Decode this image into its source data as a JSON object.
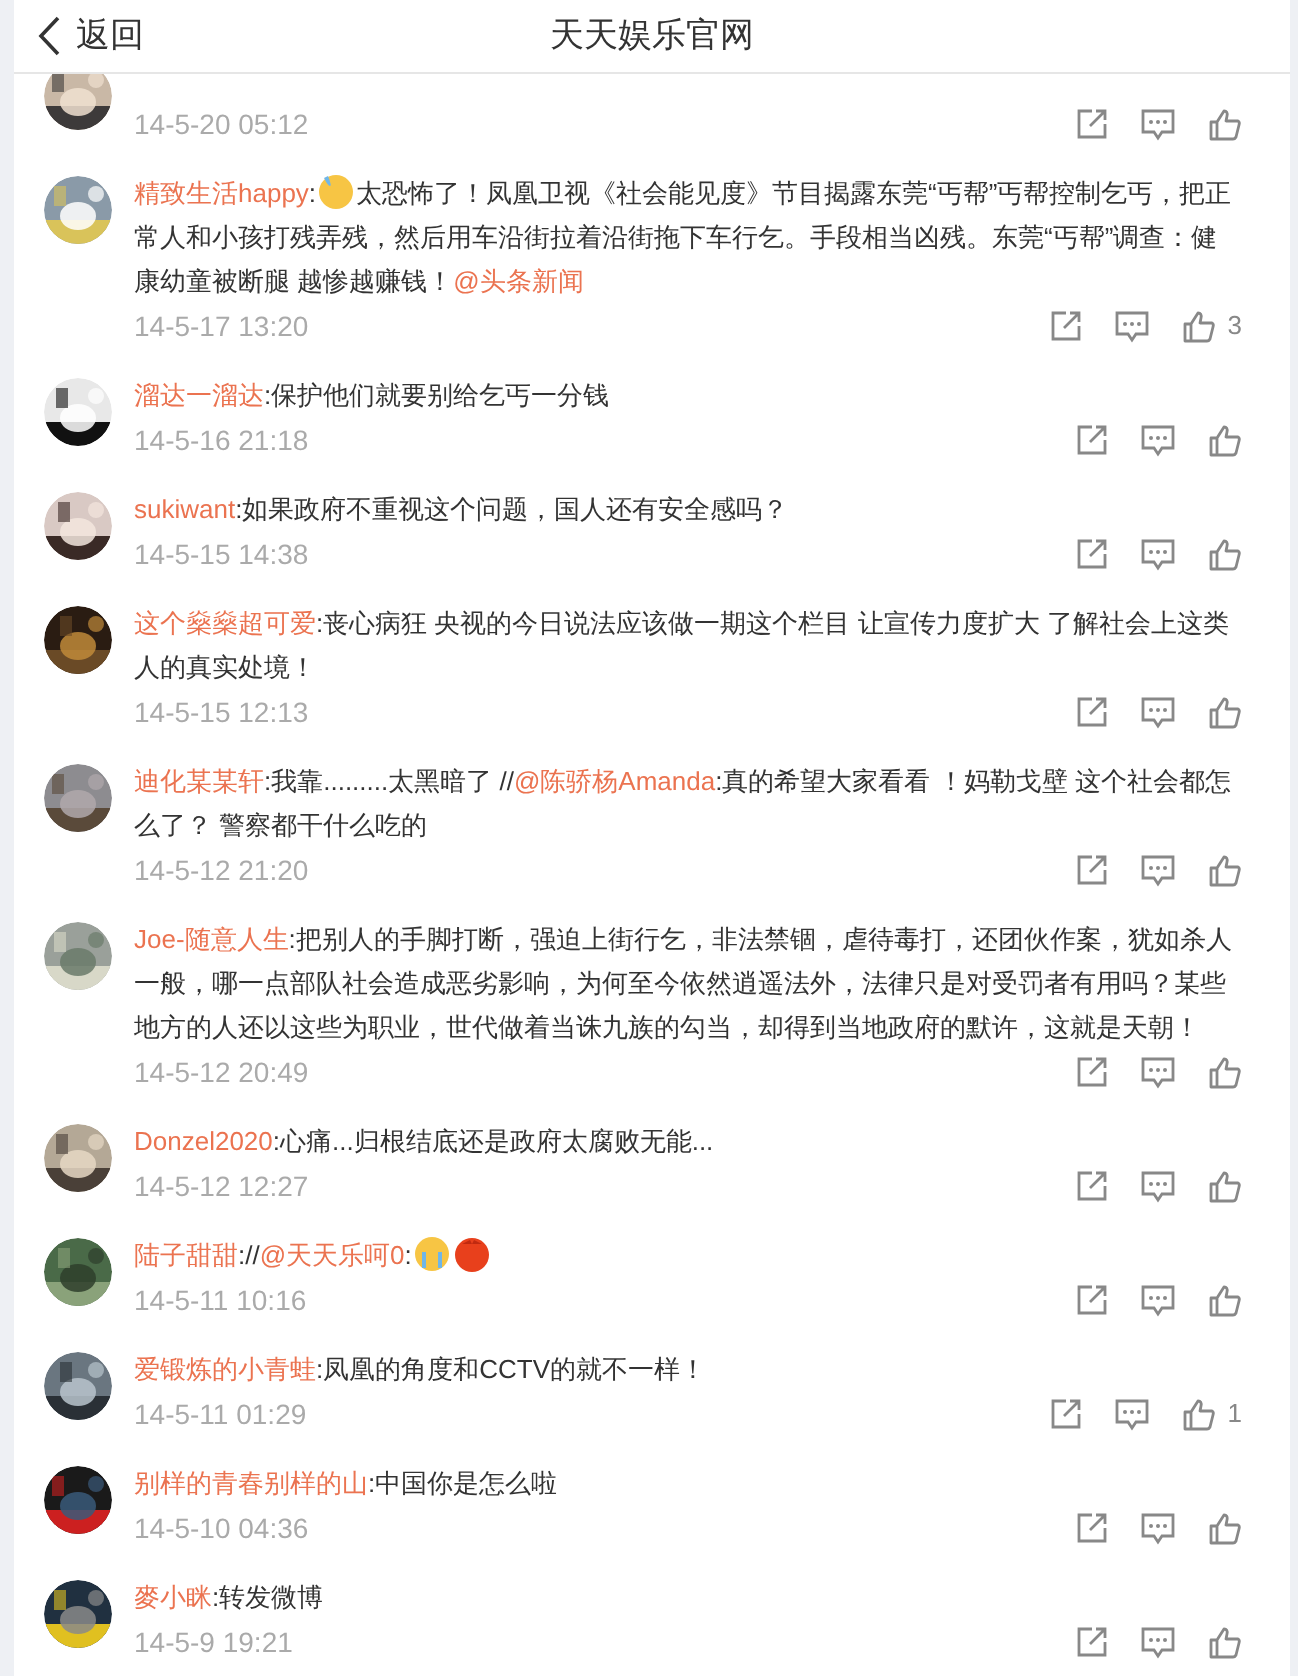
{
  "header": {
    "back_label": "返回",
    "title": "天天娱乐官网"
  },
  "comments": [
    {
      "time": "14-5-20 05:12"
    },
    {
      "name": "精致生活happy",
      "parts": [
        {
          "kind": "text",
          "text": ":"
        },
        {
          "kind": "fear"
        },
        {
          "kind": "text",
          "text": "太恐怖了！凤凰卫视《社会能见度》节目揭露东莞“丐帮”丐帮控制乞丐，把正常人和小孩打残弄残，然后用车沿街拉着沿街拖下车行乞。手段相当凶残。东莞“丐帮”调查：健康幼童被断腿 越惨越赚钱！"
        },
        {
          "kind": "mention",
          "text": "@头条新闻"
        }
      ],
      "time": "14-5-17 13:20",
      "likes": "3"
    },
    {
      "name": "溜达一溜达",
      "parts": [
        {
          "kind": "text",
          "text": ":保护他们就要别给乞丐一分钱"
        }
      ],
      "time": "14-5-16 21:18"
    },
    {
      "name": "sukiwant",
      "parts": [
        {
          "kind": "text",
          "text": ":如果政府不重视这个问题，国人还有安全感吗？"
        }
      ],
      "time": "14-5-15 14:38"
    },
    {
      "name": "这个燊燊超可爱",
      "parts": [
        {
          "kind": "text",
          "text": ":丧心病狂 央视的今日说法应该做一期这个栏目 让宣传力度扩大 了解社会上这类人的真实处境！"
        }
      ],
      "time": "14-5-15 12:13"
    },
    {
      "name": "迪化某某轩",
      "parts": [
        {
          "kind": "text",
          "text": ":我靠.........太黑暗了 //"
        },
        {
          "kind": "mention",
          "text": "@陈骄杨Amanda"
        },
        {
          "kind": "text",
          "text": ":真的希望大家看看 ！妈勒戈壁 这个社会都怎么了？ 警察都干什么吃的"
        }
      ],
      "time": "14-5-12 21:20"
    },
    {
      "name": "Joe-随意人生",
      "parts": [
        {
          "kind": "text",
          "text": ":把别人的手脚打断，强迫上街行乞，非法禁锢，虐待毒打，还团伙作案，犹如杀人一般，哪一点部队社会造成恶劣影响，为何至今依然逍遥法外，法律只是对受罚者有用吗？某些地方的人还以这些为职业，世代做着当诛九族的勾当，却得到当地政府的默许，这就是天朝！"
        }
      ],
      "time": "14-5-12 20:49"
    },
    {
      "name": "Donzel2020",
      "parts": [
        {
          "kind": "text",
          "text": ":心痛...归根结底还是政府太腐败无能..."
        }
      ],
      "time": "14-5-12 12:27"
    },
    {
      "name": "陆子甜甜",
      "parts": [
        {
          "kind": "text",
          "text": "://"
        },
        {
          "kind": "mention",
          "text": "@天天乐呵0"
        },
        {
          "kind": "text",
          "text": ":"
        },
        {
          "kind": "cry"
        },
        {
          "kind": "rage"
        }
      ],
      "time": "14-5-11 10:16"
    },
    {
      "name": "爱锻炼的小青蛙",
      "parts": [
        {
          "kind": "text",
          "text": ":凤凰的角度和CCTV的就不一样！"
        }
      ],
      "time": "14-5-11 01:29",
      "likes": "1"
    },
    {
      "name": "别样的青春别样的山",
      "parts": [
        {
          "kind": "text",
          "text": ":中国你是怎么啦"
        }
      ],
      "time": "14-5-10 04:36"
    },
    {
      "name": "麥小眯",
      "parts": [
        {
          "kind": "text",
          "text": ":转发微博"
        }
      ],
      "time": "14-5-9 19:21"
    }
  ]
}
